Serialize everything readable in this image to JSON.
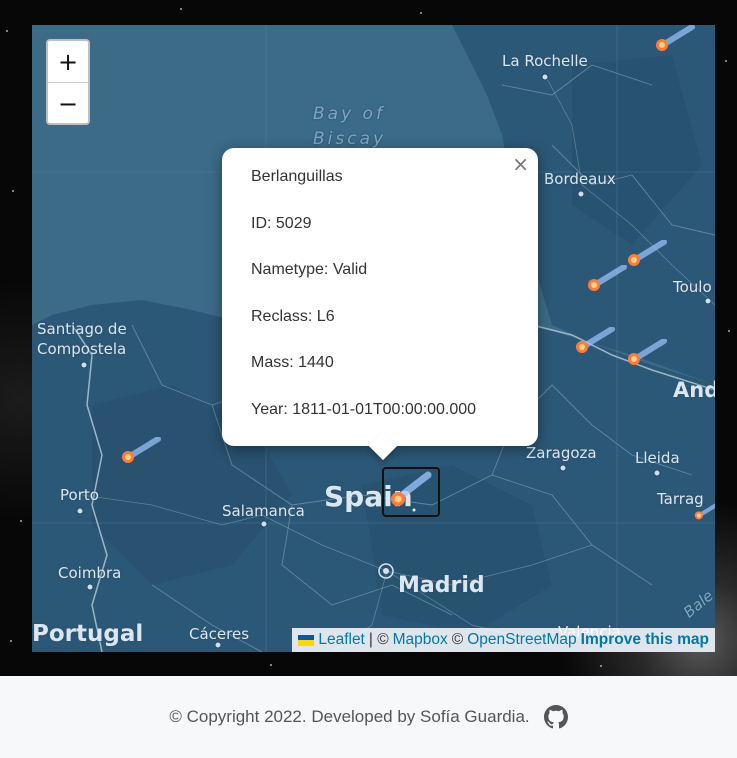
{
  "map": {
    "zoom_in": "+",
    "zoom_out": "−",
    "labels": {
      "la_rochelle": "La Rochelle",
      "bay_of_biscay_1": "Bay of",
      "bay_of_biscay_2": "Biscay",
      "bordeaux": "Bordeaux",
      "toulouse": "Toulo",
      "santiago_1": "Santiago de",
      "santiago_2": "Compostela",
      "andorra": "And",
      "zaragoza": "Zaragoza",
      "lleida": "Lleida",
      "tarragona": "Tarrag",
      "porto": "Porto",
      "spain": "Spain",
      "salamanca": "Salamanca",
      "coimbra": "Coimbra",
      "madrid": "Madrid",
      "portugal": "Portugal",
      "caceres": "Cáceres",
      "valencia": "Valencia",
      "baleares": "Bale"
    },
    "colors": {
      "land": "#2c5877",
      "sea": "#3b6b87",
      "borders": "#8aa7bd"
    }
  },
  "popup": {
    "close": "×",
    "name": "Berlanguillas",
    "id": "ID: 5029",
    "nametype": "Nametype: Valid",
    "reclass": "Reclass: L6",
    "mass": "Mass: 1440",
    "year": "Year: 1811-01-01T00:00:00.000"
  },
  "attribution": {
    "leaflet": "Leaflet",
    "sep1": "| ©",
    "mapbox": "Mapbox",
    "sep2": "©",
    "osm": "OpenStreetMap",
    "improve": "Improve this map"
  },
  "footer": {
    "copyright": "© Copyright 2022. Developed by Sofía Guardia.",
    "icon": "github-icon"
  }
}
